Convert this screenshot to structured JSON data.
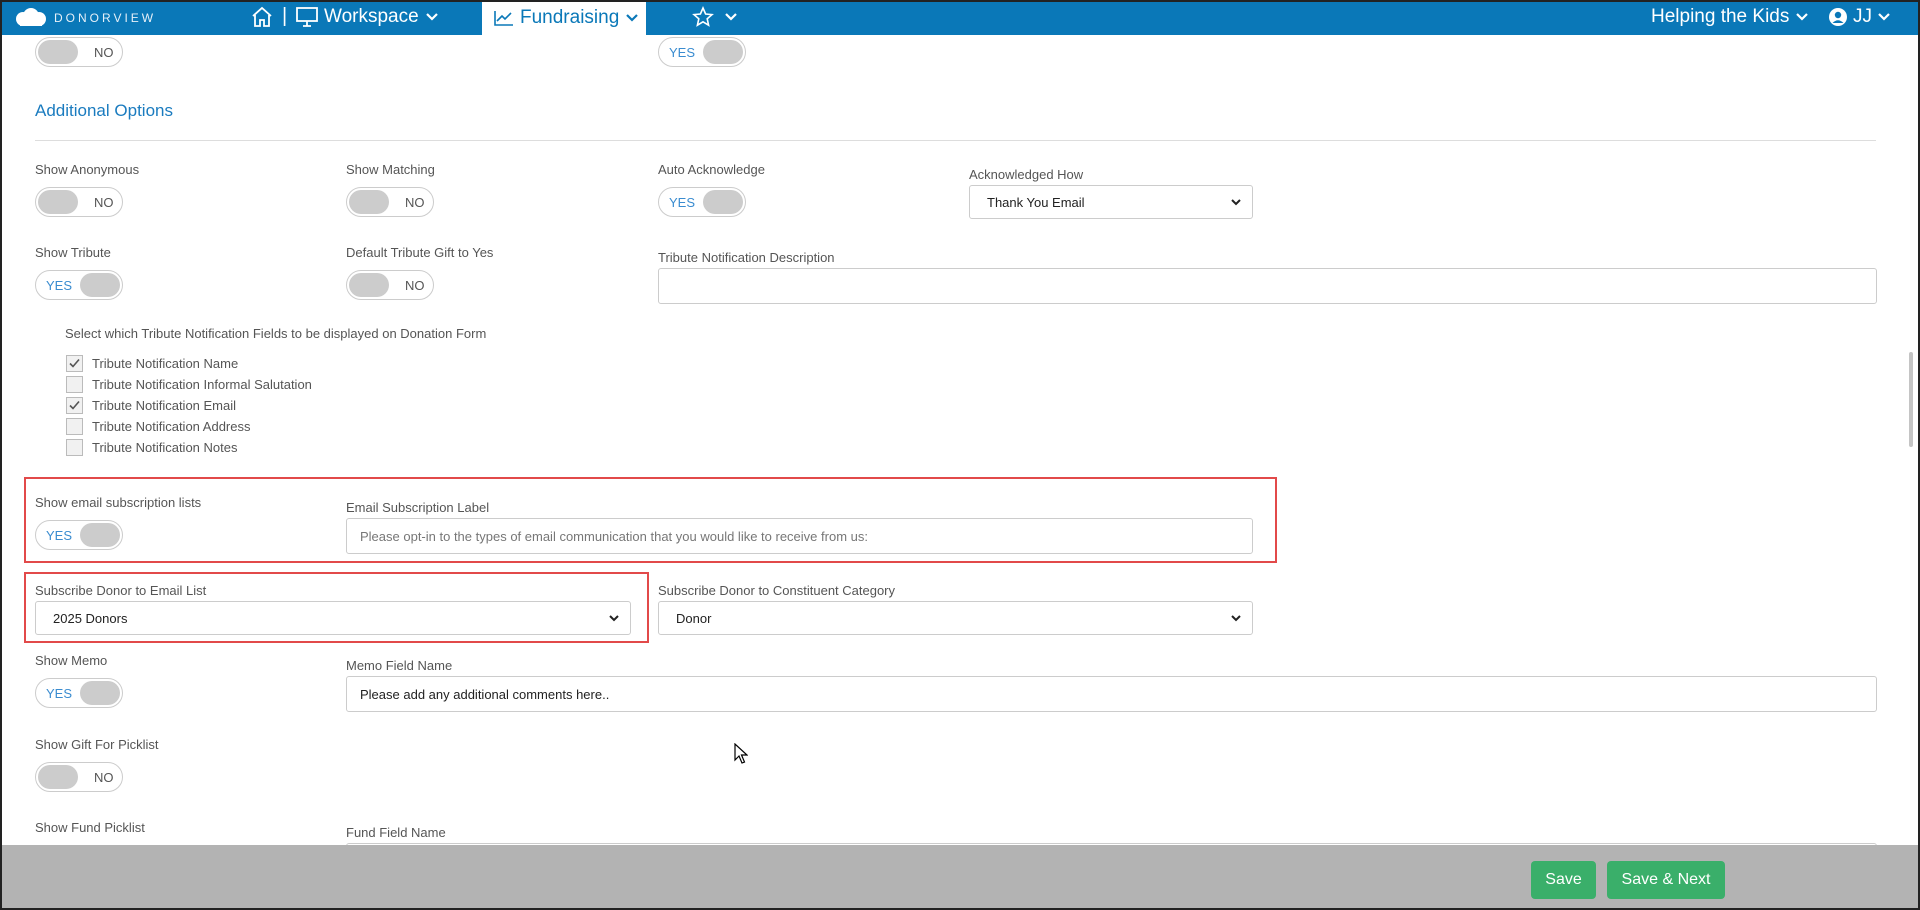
{
  "nav": {
    "logo_text": "DONORVIEW",
    "workspace": "Workspace",
    "fundraising": "Fundraising",
    "org": "Helping the Kids",
    "user": "JJ"
  },
  "top_toggles": {
    "left": "NO",
    "right": "YES"
  },
  "section_title": "Additional Options",
  "show_anonymous": {
    "label": "Show Anonymous",
    "state": "NO"
  },
  "show_matching": {
    "label": "Show Matching",
    "state": "NO"
  },
  "auto_acknowledge": {
    "label": "Auto Acknowledge",
    "state": "YES"
  },
  "acknowledged_how": {
    "label": "Acknowledged How",
    "value": "Thank You Email"
  },
  "show_tribute": {
    "label": "Show Tribute",
    "state": "YES"
  },
  "default_tribute": {
    "label": "Default Tribute Gift to Yes",
    "state": "NO"
  },
  "tribute_desc": {
    "label": "Tribute Notification Description",
    "value": ""
  },
  "tribute_fields": {
    "heading": "Select which Tribute Notification Fields to be displayed on Donation Form",
    "items": [
      {
        "label": "Tribute Notification Name",
        "checked": true
      },
      {
        "label": "Tribute Notification Informal Salutation",
        "checked": false
      },
      {
        "label": "Tribute Notification Email",
        "checked": true
      },
      {
        "label": "Tribute Notification Address",
        "checked": false
      },
      {
        "label": "Tribute Notification Notes",
        "checked": false
      }
    ]
  },
  "email_lists": {
    "label": "Show email subscription lists",
    "state": "YES"
  },
  "email_label": {
    "label": "Email Subscription Label",
    "placeholder": "Please opt-in to the types of email communication that you would like to receive from us:"
  },
  "subscribe_list": {
    "label": "Subscribe Donor to Email List",
    "value": "2025 Donors"
  },
  "subscribe_category": {
    "label": "Subscribe Donor to Constituent Category",
    "value": "Donor"
  },
  "show_memo": {
    "label": "Show Memo",
    "state": "YES"
  },
  "memo_field": {
    "label": "Memo Field Name",
    "value": "Please add any additional comments here.."
  },
  "gift_for": {
    "label": "Show Gift For Picklist",
    "state": "NO"
  },
  "fund_picklist": {
    "label": "Show Fund Picklist"
  },
  "fund_field": {
    "label": "Fund Field Name"
  },
  "footer": {
    "save": "Save",
    "save_next": "Save & Next"
  },
  "colors": {
    "nav": "#0a78b8",
    "accent": "#1a7bbf",
    "save_button": "#3aaf6a",
    "highlight": "#e24a4a"
  }
}
